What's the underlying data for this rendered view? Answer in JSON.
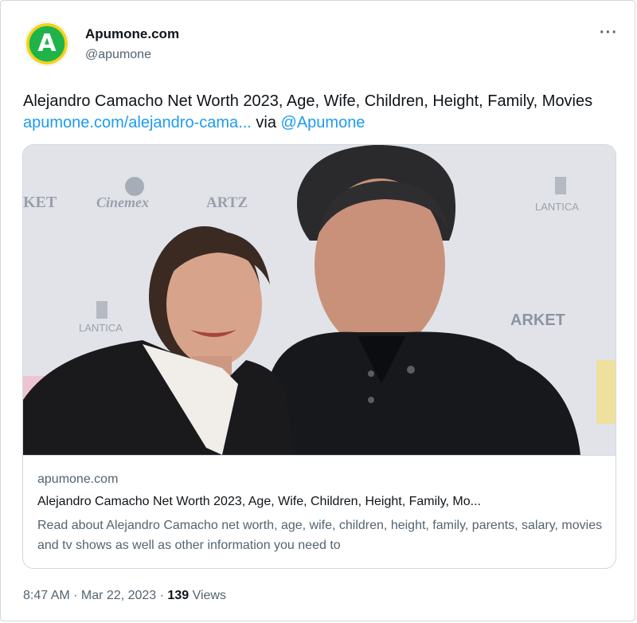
{
  "tweet": {
    "author": {
      "display_name": "Apumone.com",
      "handle": "@apumone",
      "avatar_letter": "A"
    },
    "more_icon": "···",
    "text": {
      "body": "Alejandro Camacho Net Worth 2023, Age, Wife, Children, Height, Family, Movies ",
      "link": "apumone.com/alejandro-cama...",
      "via": " via ",
      "mention": "@Apumone"
    },
    "card": {
      "image_texts": {
        "left_sponsor": "KET",
        "cinemex": "Cinemex",
        "artz": "ARTZ",
        "lantica_right": "LANTICA",
        "lantica_left": "LANTICA",
        "market": "ARKET"
      },
      "domain": "apumone.com",
      "title": "Alejandro Camacho Net Worth 2023, Age, Wife, Children, Height, Family, Mo...",
      "description": "Read about Alejandro Camacho net worth, age, wife, children, height, family, parents, salary, movies and tv shows as well as other information you need to"
    },
    "meta": {
      "time": "8:47 AM",
      "separator": " · ",
      "date": "Mar 22, 2023",
      "views_count": "139",
      "views_label": " Views"
    }
  },
  "colors": {
    "link": "#1d9bf0",
    "text": "#0f1419",
    "secondary": "#536471",
    "border": "#cfd9de"
  }
}
